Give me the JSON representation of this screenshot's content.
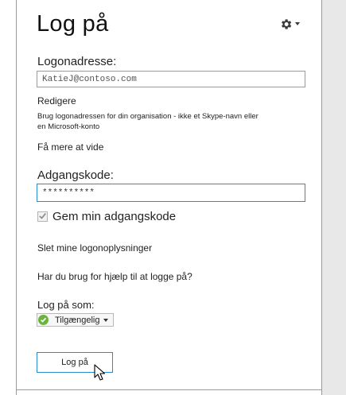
{
  "title": "Log på",
  "settings_icon": "gear-icon",
  "logon_address": {
    "label": "Logonadresse:",
    "value": "KatieJ@contoso.com",
    "edit_link": "Redigere",
    "hint_line1": "Brug logonadressen for din organisation - ikke et Skype-navn eller",
    "hint_line2": "en Microsoft-konto",
    "learn_more": "Få mere at vide"
  },
  "password": {
    "label": "Adgangskode:",
    "value": "**********"
  },
  "remember_password": {
    "label": "Gem min adgangskode",
    "checked": true
  },
  "delete_info_link": "Slet mine logonoplysninger",
  "help_link": "Har du brug for hjælp til at logge på?",
  "sign_in_as": {
    "label": "Log på som:",
    "status": "Tilgængelig",
    "status_color": "#6cb33e"
  },
  "sign_in_button": "Log på",
  "colors": {
    "focus_border": "#2a8bd3",
    "frame_border": "#9a9a9a",
    "side_panel": "#e8e8e8"
  }
}
